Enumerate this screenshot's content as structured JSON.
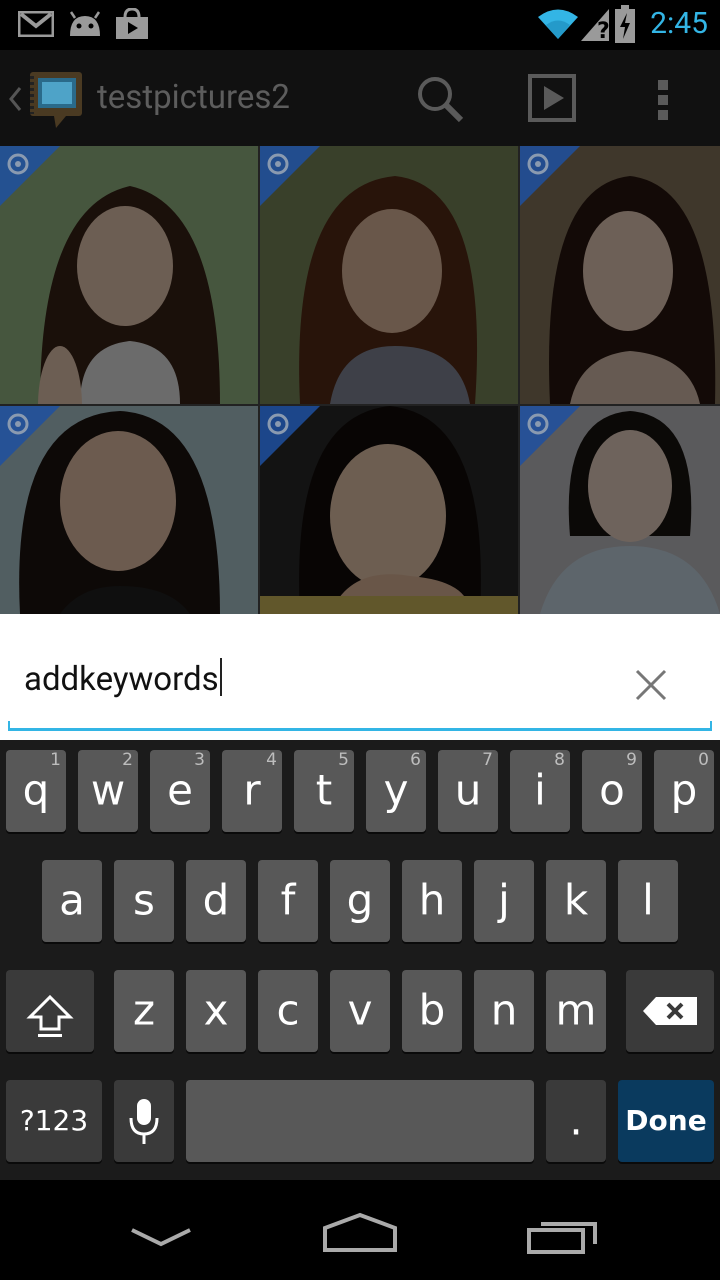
{
  "status_bar": {
    "time": "2:45",
    "icons": [
      "gmail-icon",
      "android-icon",
      "shop-icon",
      "wifi-icon",
      "no-signal-icon",
      "battery-charging-icon"
    ]
  },
  "action_bar": {
    "title": "testpictures2"
  },
  "grid": {
    "items": [
      "photo-1",
      "photo-2",
      "photo-3",
      "photo-4",
      "photo-5",
      "photo-6"
    ]
  },
  "search": {
    "query": "addkeywords"
  },
  "keyboard": {
    "row1": [
      {
        "label": "q",
        "hint": "1"
      },
      {
        "label": "w",
        "hint": "2"
      },
      {
        "label": "e",
        "hint": "3"
      },
      {
        "label": "r",
        "hint": "4"
      },
      {
        "label": "t",
        "hint": "5"
      },
      {
        "label": "y",
        "hint": "6"
      },
      {
        "label": "u",
        "hint": "7"
      },
      {
        "label": "i",
        "hint": "8"
      },
      {
        "label": "o",
        "hint": "9"
      },
      {
        "label": "p",
        "hint": "0"
      }
    ],
    "row2": [
      "a",
      "s",
      "d",
      "f",
      "g",
      "h",
      "j",
      "k",
      "l"
    ],
    "row3": [
      "z",
      "x",
      "c",
      "v",
      "b",
      "n",
      "m"
    ],
    "symbols_label": "?123",
    "period_label": ".",
    "done_label": "Done"
  },
  "nav": {
    "buttons": [
      "back-icon",
      "home-icon",
      "recent-apps-icon"
    ]
  }
}
